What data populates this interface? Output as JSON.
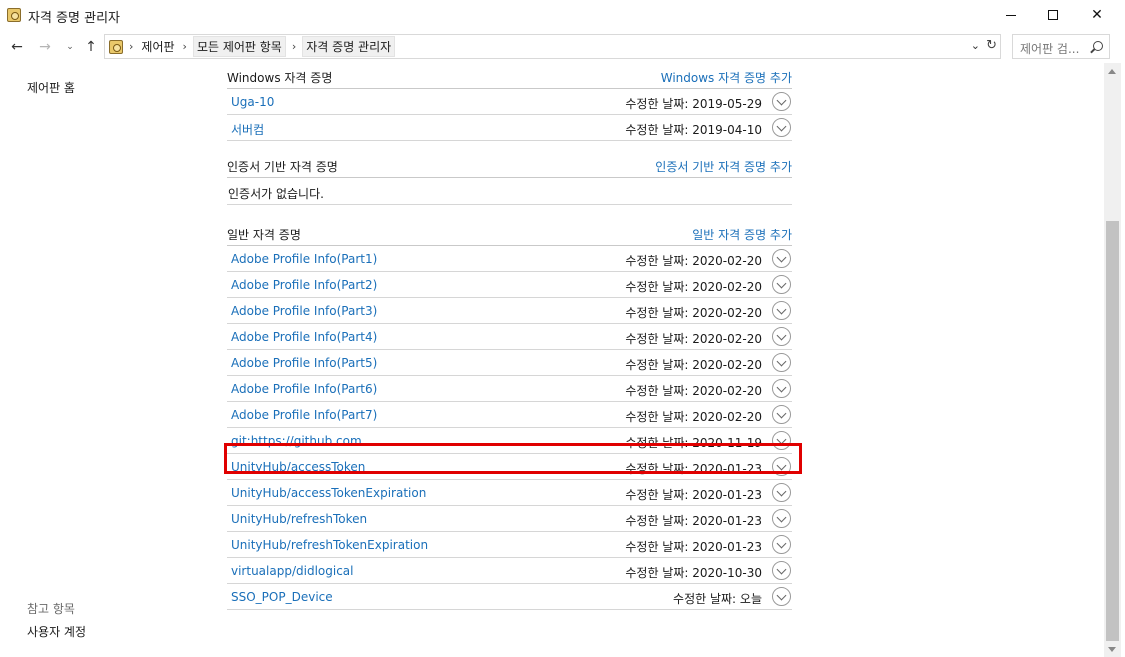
{
  "window": {
    "title": "자격 증명 관리자",
    "minimize_glyph": "—",
    "maximize_glyph": "☐",
    "close_glyph": "✕"
  },
  "nav": {
    "back_glyph": "←",
    "forward_glyph": "→",
    "recent_glyph": "⌄",
    "up_glyph": "↑",
    "breadcrumb": [
      "제어판",
      "모든 제어판 항목",
      "자격 증명 관리자"
    ],
    "crumb_sep": "›",
    "dropdown_glyph": "⌄",
    "refresh_glyph": "↻",
    "search_placeholder": "제어판 검..."
  },
  "left_pane": {
    "home_link": "제어판 홈",
    "see_also_label": "참고 항목",
    "user_accounts_link": "사용자 계정"
  },
  "windows_section": {
    "title": "Windows 자격 증명",
    "add_link": "Windows 자격 증명 추가",
    "items": [
      {
        "name": "Uga-10",
        "date": "수정한 날짜:  2019-05-29"
      },
      {
        "name": "서버컴",
        "date": "수정한 날짜:  2019-04-10"
      }
    ]
  },
  "cert_section": {
    "title": "인증서 기반 자격 증명",
    "add_link": "인증서 기반 자격 증명 추가",
    "empty_text": "인증서가 없습니다."
  },
  "generic_section": {
    "title": "일반 자격 증명",
    "add_link": "일반 자격 증명 추가",
    "items": [
      {
        "name": "Adobe Profile Info(Part1)",
        "date": "수정한 날짜:  2020-02-20"
      },
      {
        "name": "Adobe Profile Info(Part2)",
        "date": "수정한 날짜:  2020-02-20"
      },
      {
        "name": "Adobe Profile Info(Part3)",
        "date": "수정한 날짜:  2020-02-20"
      },
      {
        "name": "Adobe Profile Info(Part4)",
        "date": "수정한 날짜:  2020-02-20"
      },
      {
        "name": "Adobe Profile Info(Part5)",
        "date": "수정한 날짜:  2020-02-20"
      },
      {
        "name": "Adobe Profile Info(Part6)",
        "date": "수정한 날짜:  2020-02-20"
      },
      {
        "name": "Adobe Profile Info(Part7)",
        "date": "수정한 날짜:  2020-02-20"
      },
      {
        "name": "git:https://github.com",
        "date": "수정한 날짜:  2020-11-19"
      },
      {
        "name": "UnityHub/accessToken",
        "date": "수정한 날짜:  2020-01-23"
      },
      {
        "name": "UnityHub/accessTokenExpiration",
        "date": "수정한 날짜:  2020-01-23"
      },
      {
        "name": "UnityHub/refreshToken",
        "date": "수정한 날짜:  2020-01-23"
      },
      {
        "name": "UnityHub/refreshTokenExpiration",
        "date": "수정한 날짜:  2020-01-23"
      },
      {
        "name": "virtualapp/didlogical",
        "date": "수정한 날짜:  2020-10-30"
      },
      {
        "name": "SSO_POP_Device",
        "date": "수정한 날짜:  오늘"
      }
    ]
  },
  "colors": {
    "link": "#1a6fb9",
    "highlight": "#e00000"
  }
}
